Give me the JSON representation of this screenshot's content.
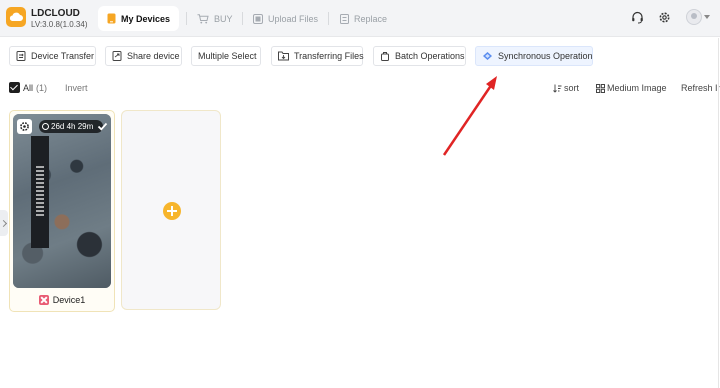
{
  "app": {
    "name": "LDCLOUD",
    "version": "LV:3.0.8(1.0.34)",
    "brand_color": "#f6a623"
  },
  "tabs": [
    {
      "label": "My Devices",
      "icon": "phone-icon",
      "active": true
    },
    {
      "label": "BUY",
      "icon": "cart-icon",
      "active": false
    },
    {
      "label": "Upload Files",
      "icon": "upload-icon",
      "active": false
    },
    {
      "label": "Replace",
      "icon": "replace-icon",
      "active": false
    }
  ],
  "toolbar": {
    "device_transfer": "Device Transfer",
    "share_device": "Share device",
    "multiple_select": "Multiple Select",
    "transferring_files": "Transferring Files",
    "batch_operations": "Batch Operations",
    "synchronous_operation": "Synchronous Operation"
  },
  "filter": {
    "all_label": "All",
    "count": "(1)",
    "invert": "Invert",
    "sort": "sort",
    "medium_image": "Medium Image",
    "refresh": "Refresh In"
  },
  "devices": [
    {
      "name": "Device1",
      "timer": "26d 4h 29m",
      "icon_color": "#e85c74"
    }
  ],
  "annotation": {
    "arrow_color": "#e02424"
  }
}
